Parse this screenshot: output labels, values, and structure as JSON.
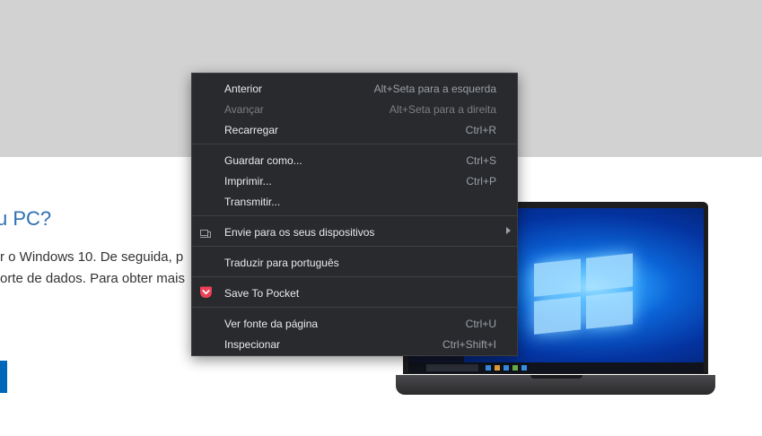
{
  "page": {
    "heading": "u PC?",
    "line1": "r o Windows 10. De seguida, p",
    "line2": "orte de dados. Para obter mais"
  },
  "context_menu": {
    "items": [
      {
        "label": "Anterior",
        "shortcut": "Alt+Seta para a esquerda"
      },
      {
        "label": "Avançar",
        "shortcut": "Alt+Seta para a direita",
        "disabled": true
      },
      {
        "label": "Recarregar",
        "shortcut": "Ctrl+R"
      },
      {
        "label": "Guardar como...",
        "shortcut": "Ctrl+S"
      },
      {
        "label": "Imprimir...",
        "shortcut": "Ctrl+P"
      },
      {
        "label": "Transmitir...",
        "shortcut": ""
      },
      {
        "label": "Envie para os seus dispositivos",
        "shortcut": "",
        "icon": "devices-icon",
        "submenu": true
      },
      {
        "label": "Traduzir para português",
        "shortcut": ""
      },
      {
        "label": "Save To Pocket",
        "shortcut": "",
        "icon": "pocket-icon"
      },
      {
        "label": "Ver fonte da página",
        "shortcut": "Ctrl+U"
      },
      {
        "label": "Inspecionar",
        "shortcut": "Ctrl+Shift+I"
      }
    ]
  },
  "colors": {
    "menu_bg": "#292a2d",
    "menu_text": "#e8eaed",
    "disabled_text": "#7b7e83",
    "pocket_red": "#ef4056",
    "top_band": "#d2d2d2",
    "heading_blue": "#2f6fb3",
    "button_blue": "#0067b8"
  }
}
